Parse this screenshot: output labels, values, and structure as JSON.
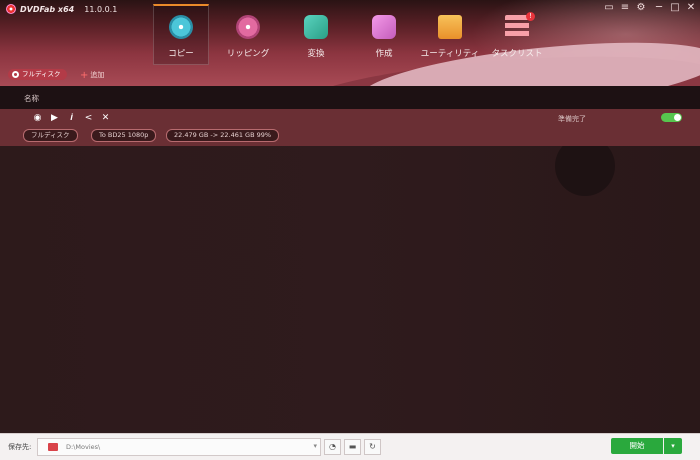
{
  "app": {
    "name": "DVDFab x64",
    "version": "11.0.0.1"
  },
  "nav": [
    {
      "label": "コピー",
      "icon": "copy-disc-icon",
      "color": "#4cc6d9",
      "selected": true
    },
    {
      "label": "リッピング",
      "icon": "ripper-disc-icon",
      "color": "#e26aa0",
      "selected": false
    },
    {
      "label": "変換",
      "icon": "convert-video-icon",
      "color": "#3cc0a8",
      "selected": false
    },
    {
      "label": "作成",
      "icon": "creator-icon",
      "color": "#e07ad6",
      "selected": false
    },
    {
      "label": "ユーティリティ",
      "icon": "utility-folder-icon",
      "color": "#f2a640",
      "selected": false
    },
    {
      "label": "タスクリスト",
      "icon": "task-list-icon",
      "color": "#f08090",
      "selected": false
    }
  ],
  "task_badge": "!",
  "toolbar": {
    "mode_label": "フルディスク",
    "add_label": "追加"
  },
  "table": {
    "header_name": "名称"
  },
  "task": {
    "status": "準備完了",
    "toggle_on": true,
    "tags": [
      "フルディスク",
      "To BD25 1080p",
      "22.479 GB -> 22.461 GB 99%"
    ]
  },
  "bottom": {
    "save_label": "保存先:",
    "path": "D:\\Movies\\",
    "start_label": "開始"
  }
}
